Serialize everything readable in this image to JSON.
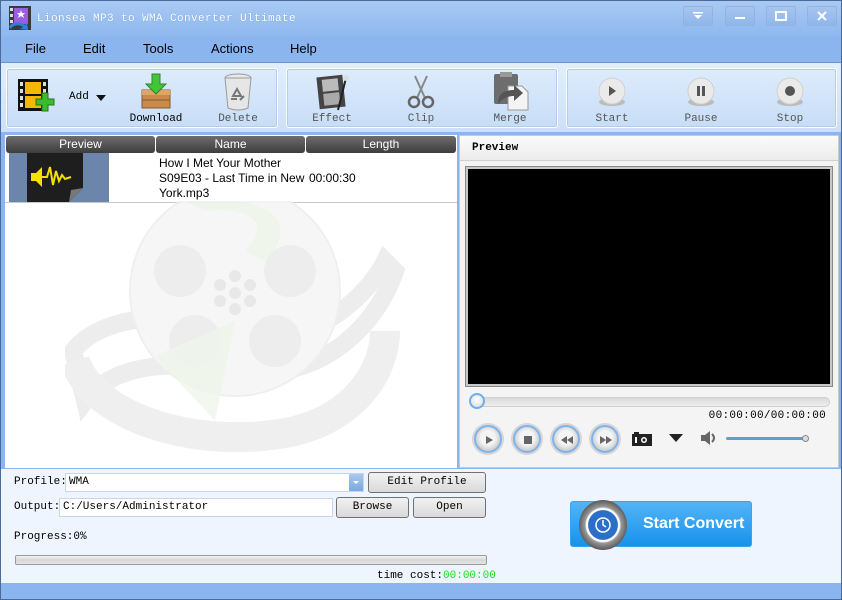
{
  "window": {
    "title": "Lionsea MP3 to WMA Converter Ultimate",
    "controls": [
      "skin-menu",
      "minimize",
      "maximize",
      "close"
    ]
  },
  "menu": {
    "items": [
      {
        "label": "File"
      },
      {
        "label": "Edit"
      },
      {
        "label": "Tools"
      },
      {
        "label": "Actions"
      },
      {
        "label": "Help"
      }
    ]
  },
  "toolbar": {
    "add": "Add",
    "download": "Download",
    "delete": "Delete",
    "effect": "Effect",
    "clip": "Clip",
    "merge": "Merge",
    "start": "Start",
    "pause": "Pause",
    "stop": "Stop"
  },
  "file_list": {
    "columns": [
      "Preview",
      "Name",
      "Length"
    ],
    "rows": [
      {
        "name": "How I Met Your Mother S09E03 - Last Time in New York.mp3",
        "length": "00:00:30",
        "icon": "audio-file-icon"
      }
    ]
  },
  "preview": {
    "title": "Preview",
    "time": "00:00:00/00:00:00",
    "seek_fraction": 0.0,
    "volume_fraction": 1.0
  },
  "output": {
    "profile_label": "Profile:",
    "profile_value": "WMA",
    "edit_profile": "Edit Profile",
    "output_label": "Output:",
    "output_value": "C:/Users/Administrator",
    "browse": "Browse",
    "open": "Open",
    "progress_label": "Progress:",
    "progress_value": "0%",
    "progress_fraction": 0.0,
    "time_cost_label": "time cost:",
    "time_cost_value": "00:00:00",
    "start_convert": "Start Convert"
  },
  "colors": {
    "window_frame": "#8ab5ee",
    "accent_blue": "#1792eb",
    "time_cost_green": "#22dd22"
  }
}
